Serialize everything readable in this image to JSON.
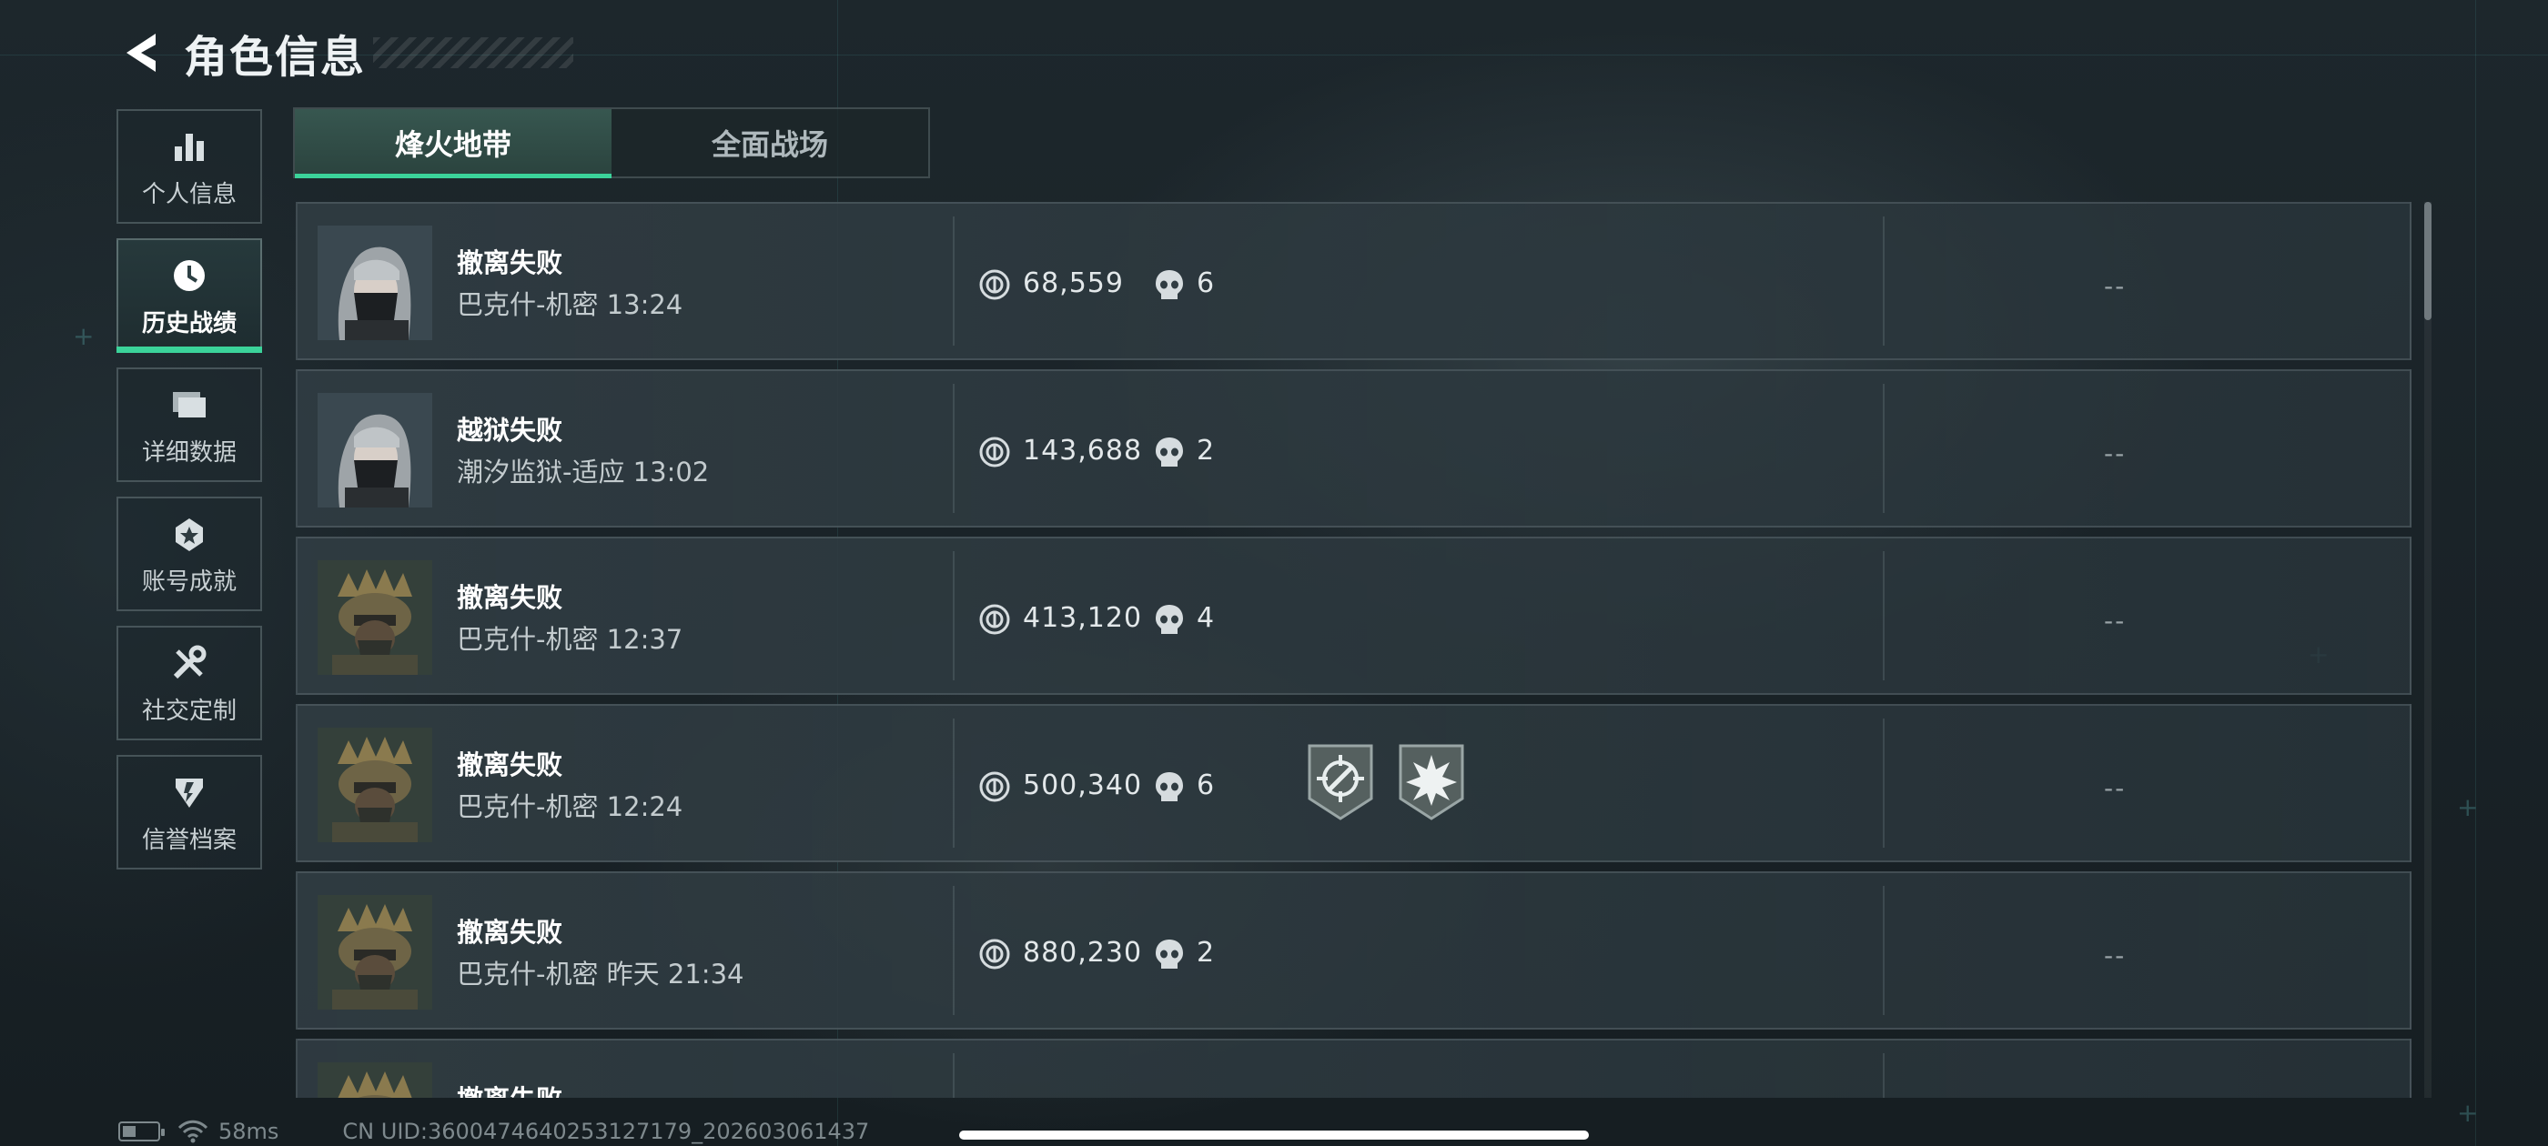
{
  "header": {
    "title": "角色信息",
    "back_icon": "chevron-left-icon"
  },
  "sidebar": {
    "items": [
      {
        "label": "个人信息",
        "icon": "bar-chart-icon",
        "active": false
      },
      {
        "label": "历史战绩",
        "icon": "history-clock-icon",
        "active": true
      },
      {
        "label": "详细数据",
        "icon": "folders-icon",
        "active": false
      },
      {
        "label": "账号成就",
        "icon": "medal-icon",
        "active": false
      },
      {
        "label": "社交定制",
        "icon": "tools-icon",
        "active": false
      },
      {
        "label": "信誉档案",
        "icon": "shield-icon",
        "active": false
      }
    ]
  },
  "tabs": [
    {
      "label": "烽火地带",
      "active": true
    },
    {
      "label": "全面战场",
      "active": false
    }
  ],
  "matches": [
    {
      "avatar": "operator-female-masked",
      "result": "撤离失败",
      "map": "巴克什-机密 13:24",
      "value": "68,559",
      "kills": "6",
      "badges": [],
      "rank": "--"
    },
    {
      "avatar": "operator-female-masked",
      "result": "越狱失败",
      "map": "潮汐监狱-适应 13:02",
      "value": "143,688",
      "kills": "2",
      "badges": [],
      "rank": "--"
    },
    {
      "avatar": "operator-helmet-soldier",
      "result": "撤离失败",
      "map": "巴克什-机密 12:37",
      "value": "413,120",
      "kills": "4",
      "badges": [],
      "rank": "--"
    },
    {
      "avatar": "operator-helmet-soldier",
      "result": "撤离失败",
      "map": "巴克什-机密 12:24",
      "value": "500,340",
      "kills": "6",
      "badges": [
        "crosshair-badge-icon",
        "explosion-badge-icon"
      ],
      "rank": "--"
    },
    {
      "avatar": "operator-helmet-soldier",
      "result": "撤离失败",
      "map": "巴克什-机密 昨天 21:34",
      "value": "880,230",
      "kills": "2",
      "badges": [],
      "rank": "--"
    },
    {
      "avatar": "operator-helmet-soldier",
      "result": "撤离失败",
      "map": "",
      "value": "",
      "kills": "",
      "badges": [],
      "rank": ""
    }
  ],
  "status_bar": {
    "ping": "58ms",
    "uid": "CN UID:3600474640253127179_202603061437"
  },
  "colors": {
    "accent": "#3bd39a",
    "background": "#1a2328",
    "row_bg": "#2f3c42"
  }
}
